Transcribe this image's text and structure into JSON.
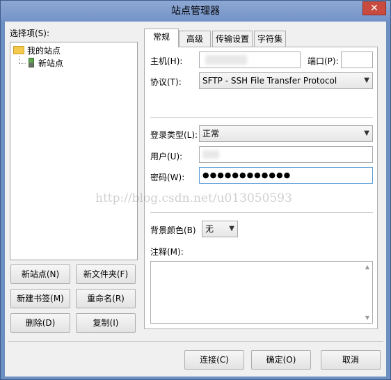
{
  "window": {
    "title": "站点管理器",
    "close_glyph": "✕"
  },
  "tree": {
    "label": "选择项(S):",
    "items": [
      {
        "label": "我的站点",
        "icon": "folder-icon"
      },
      {
        "label": "新站点",
        "icon": "site-icon"
      }
    ]
  },
  "buttons_left": {
    "new_site": "新站点(N)",
    "new_folder": "新文件夹(F)",
    "new_bookmark": "新建书签(M)",
    "rename": "重命名(R)",
    "delete": "删除(D)",
    "copy": "复制(I)"
  },
  "tabs": [
    "常规",
    "高级",
    "传输设置",
    "字符集"
  ],
  "general": {
    "host_label": "主机(H):",
    "port_label": "端口(P):",
    "port_value": "",
    "protocol_label": "协议(T):",
    "protocol_value": "SFTP - SSH File Transfer Protocol",
    "logon_label": "登录类型(L):",
    "logon_value": "正常",
    "user_label": "用户(U):",
    "password_label": "密码(W):",
    "password_value": "●●●●●●●●●●●●",
    "bgcolor_label": "背景颜色(B)",
    "bgcolor_value": "无",
    "comments_label": "注释(M):"
  },
  "bottom_buttons": {
    "connect": "连接(C)",
    "ok": "确定(O)",
    "cancel": "取消"
  },
  "watermark": "http://blog.csdn.net/u013050593"
}
